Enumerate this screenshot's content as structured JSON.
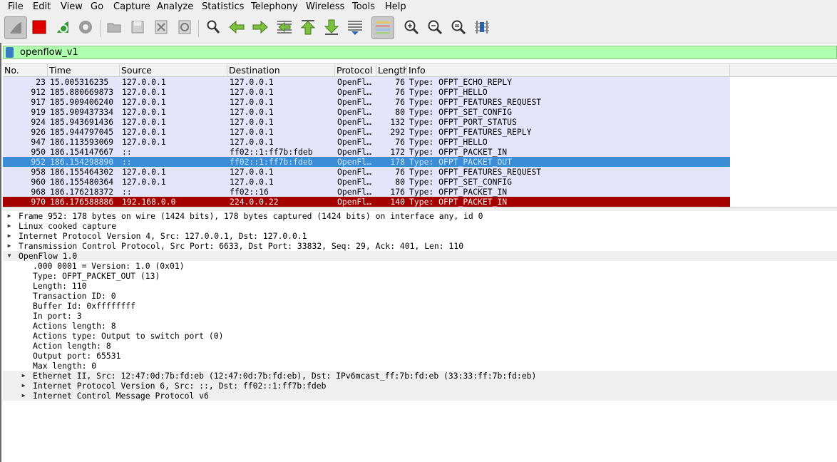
{
  "menubar": {
    "items": [
      {
        "label": "File"
      },
      {
        "label": "Edit"
      },
      {
        "label": "View"
      },
      {
        "label": "Go"
      },
      {
        "label": "Capture"
      },
      {
        "label": "Analyze"
      },
      {
        "label": "Statistics"
      },
      {
        "label": "Telephony"
      },
      {
        "label": "Wireless"
      },
      {
        "label": "Tools"
      },
      {
        "label": "Help"
      }
    ]
  },
  "toolbar": {
    "buttons": [
      {
        "icon": "shark-fin-icon"
      },
      {
        "icon": "stop-capture-icon"
      },
      {
        "icon": "restart-capture-icon"
      },
      {
        "icon": "capture-options-icon"
      },
      {
        "icon": "open-file-icon"
      },
      {
        "icon": "save-file-icon"
      },
      {
        "icon": "close-file-icon"
      },
      {
        "icon": "reload-file-icon"
      },
      {
        "icon": "find-packet-icon"
      },
      {
        "icon": "go-back-icon"
      },
      {
        "icon": "go-forward-icon"
      },
      {
        "icon": "go-to-packet-icon"
      },
      {
        "icon": "first-packet-icon"
      },
      {
        "icon": "last-packet-icon"
      },
      {
        "icon": "autoscroll-icon"
      },
      {
        "icon": "colorize-icon"
      },
      {
        "icon": "zoom-in-icon"
      },
      {
        "icon": "zoom-out-icon"
      },
      {
        "icon": "normal-size-icon"
      },
      {
        "icon": "resize-columns-icon"
      }
    ]
  },
  "filter": {
    "value": "openflow_v1",
    "bg_color": "#afffaf"
  },
  "packet_list": {
    "columns": [
      "No.",
      "Time",
      "Source",
      "Destination",
      "Protocol",
      "Length",
      "Info"
    ],
    "rows": [
      {
        "no": "23",
        "time": "15.005316235",
        "source": "127.0.0.1",
        "destination": "127.0.0.1",
        "protocol": "OpenFl…",
        "length": "76",
        "info": "Type: OFPT_ECHO_REPLY",
        "state": "normal"
      },
      {
        "no": "912",
        "time": "185.880669873",
        "source": "127.0.0.1",
        "destination": "127.0.0.1",
        "protocol": "OpenFl…",
        "length": "76",
        "info": "Type: OFPT_HELLO",
        "state": "normal"
      },
      {
        "no": "917",
        "time": "185.909406240",
        "source": "127.0.0.1",
        "destination": "127.0.0.1",
        "protocol": "OpenFl…",
        "length": "76",
        "info": "Type: OFPT_FEATURES_REQUEST",
        "state": "normal"
      },
      {
        "no": "919",
        "time": "185.909437334",
        "source": "127.0.0.1",
        "destination": "127.0.0.1",
        "protocol": "OpenFl…",
        "length": "80",
        "info": "Type: OFPT_SET_CONFIG",
        "state": "normal"
      },
      {
        "no": "924",
        "time": "185.943691436",
        "source": "127.0.0.1",
        "destination": "127.0.0.1",
        "protocol": "OpenFl…",
        "length": "132",
        "info": "Type: OFPT_PORT_STATUS",
        "state": "normal"
      },
      {
        "no": "926",
        "time": "185.944797045",
        "source": "127.0.0.1",
        "destination": "127.0.0.1",
        "protocol": "OpenFl…",
        "length": "292",
        "info": "Type: OFPT_FEATURES_REPLY",
        "state": "normal"
      },
      {
        "no": "947",
        "time": "186.113593069",
        "source": "127.0.0.1",
        "destination": "127.0.0.1",
        "protocol": "OpenFl…",
        "length": "76",
        "info": "Type: OFPT_HELLO",
        "state": "normal"
      },
      {
        "no": "950",
        "time": "186.154147667",
        "source": "::",
        "destination": "ff02::1:ff7b:fdeb",
        "protocol": "OpenFl…",
        "length": "172",
        "info": "Type: OFPT_PACKET_IN",
        "state": "normal"
      },
      {
        "no": "952",
        "time": "186.154298890",
        "source": "::",
        "destination": "ff02::1:ff7b:fdeb",
        "protocol": "OpenFl…",
        "length": "178",
        "info": "Type: OFPT_PACKET_OUT",
        "state": "selected"
      },
      {
        "no": "958",
        "time": "186.155464302",
        "source": "127.0.0.1",
        "destination": "127.0.0.1",
        "protocol": "OpenFl…",
        "length": "76",
        "info": "Type: OFPT_FEATURES_REQUEST",
        "state": "normal"
      },
      {
        "no": "960",
        "time": "186.155480364",
        "source": "127.0.0.1",
        "destination": "127.0.0.1",
        "protocol": "OpenFl…",
        "length": "80",
        "info": "Type: OFPT_SET_CONFIG",
        "state": "normal"
      },
      {
        "no": "968",
        "time": "186.176218372",
        "source": "::",
        "destination": "ff02::16",
        "protocol": "OpenFl…",
        "length": "176",
        "info": "Type: OFPT_PACKET_IN",
        "state": "normal"
      },
      {
        "no": "970",
        "time": "186.176588886",
        "source": "192.168.0.0",
        "destination": "224.0.0.22",
        "protocol": "OpenFl…",
        "length": "140",
        "info": "Type: OFPT_PACKET_IN",
        "state": "error"
      }
    ]
  },
  "details": {
    "rows": [
      {
        "text": "Frame 952: 178 bytes on wire (1424 bits), 178 bytes captured (1424 bits) on interface any, id 0",
        "level": 0,
        "expander": "collapsed",
        "shade": false
      },
      {
        "text": "Linux cooked capture",
        "level": 0,
        "expander": "collapsed",
        "shade": false
      },
      {
        "text": "Internet Protocol Version 4, Src: 127.0.0.1, Dst: 127.0.0.1",
        "level": 0,
        "expander": "collapsed",
        "shade": false
      },
      {
        "text": "Transmission Control Protocol, Src Port: 6633, Dst Port: 33832, Seq: 29, Ack: 401, Len: 110",
        "level": 0,
        "expander": "collapsed",
        "shade": false
      },
      {
        "text": "OpenFlow 1.0",
        "level": 0,
        "expander": "expanded",
        "shade": true
      },
      {
        "text": ".000 0001 = Version: 1.0 (0x01)",
        "level": 1,
        "expander": "none",
        "shade": false
      },
      {
        "text": "Type: OFPT_PACKET_OUT (13)",
        "level": 1,
        "expander": "none",
        "shade": false
      },
      {
        "text": "Length: 110",
        "level": 1,
        "expander": "none",
        "shade": false
      },
      {
        "text": "Transaction ID: 0",
        "level": 1,
        "expander": "none",
        "shade": false
      },
      {
        "text": "Buffer Id: 0xffffffff",
        "level": 1,
        "expander": "none",
        "shade": false
      },
      {
        "text": "In port: 3",
        "level": 1,
        "expander": "none",
        "shade": false
      },
      {
        "text": "Actions length: 8",
        "level": 1,
        "expander": "none",
        "shade": false
      },
      {
        "text": "Actions type: Output to switch port (0)",
        "level": 1,
        "expander": "none",
        "shade": false
      },
      {
        "text": "Action length: 8",
        "level": 1,
        "expander": "none",
        "shade": false
      },
      {
        "text": "Output port: 65531",
        "level": 1,
        "expander": "none",
        "shade": false
      },
      {
        "text": "Max length: 0",
        "level": 1,
        "expander": "none",
        "shade": false
      },
      {
        "text": "Ethernet II, Src: 12:47:0d:7b:fd:eb (12:47:0d:7b:fd:eb), Dst: IPv6mcast_ff:7b:fd:eb (33:33:ff:7b:fd:eb)",
        "level": 1,
        "expander": "collapsed",
        "shade": true
      },
      {
        "text": "Internet Protocol Version 6, Src: ::, Dst: ff02::1:ff7b:fdeb",
        "level": 1,
        "expander": "collapsed",
        "shade": true
      },
      {
        "text": "Internet Control Message Protocol v6",
        "level": 1,
        "expander": "collapsed",
        "shade": true
      }
    ]
  }
}
